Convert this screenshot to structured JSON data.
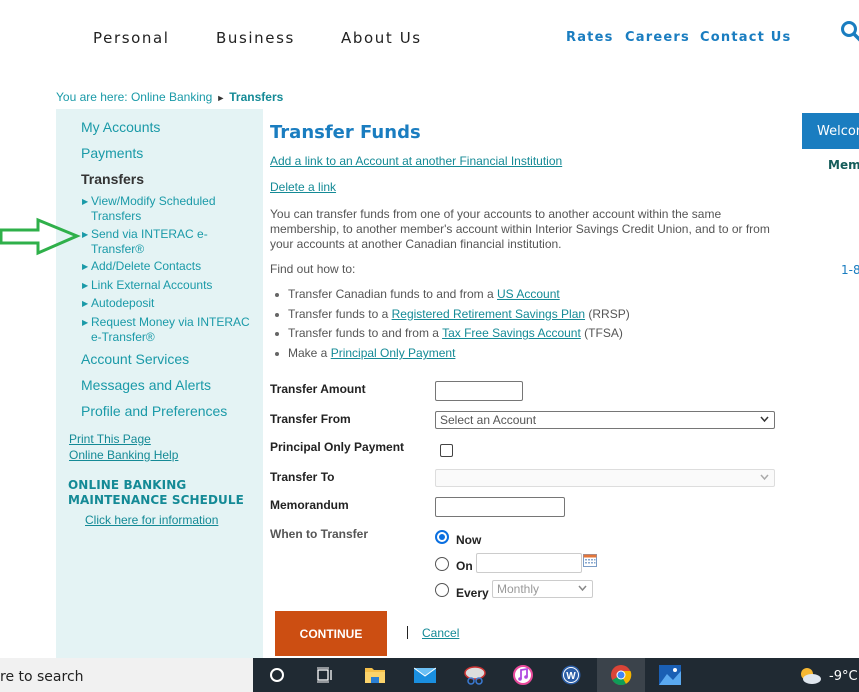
{
  "nav": {
    "main": [
      "Personal",
      "Business",
      "About Us"
    ],
    "util": [
      "Rates",
      "Careers",
      "Contact Us"
    ],
    "search_icon": "search-icon"
  },
  "breadcrumb": {
    "prefix": "You are here: Online Banking",
    "separator": "►",
    "current": "Transfers"
  },
  "sidebar": {
    "items": [
      {
        "label": "My Accounts"
      },
      {
        "label": "Payments"
      },
      {
        "label": "Transfers",
        "active": true
      },
      {
        "label": "Account Services"
      },
      {
        "label": "Messages and Alerts"
      },
      {
        "label": "Profile and Preferences"
      }
    ],
    "sub_items": [
      {
        "line1": "View/Modify Scheduled",
        "line2": "Transfers"
      },
      {
        "line1": "Send via INTERAC e-",
        "line2": "Transfer®"
      },
      {
        "line1": "Add/Delete Contacts"
      },
      {
        "line1": "Link External Accounts"
      },
      {
        "line1": "Autodeposit"
      },
      {
        "line1": "Request Money via INTERAC",
        "line2": "e-Transfer®"
      }
    ],
    "links": [
      "Print This Page",
      "Online Banking Help"
    ],
    "maintenance_title_1": "ONLINE BANKING",
    "maintenance_title_2": "MAINTENANCE SCHEDULE",
    "maintenance_link": "Click here for information"
  },
  "main": {
    "title": "Transfer Funds",
    "add_link": "Add a link to an Account at another Financial Institution",
    "delete_link": "Delete a link",
    "intro": "You can transfer funds from one of your accounts to another account within the same membership, to another member's account within Interior Savings Credit Union, and to or from your accounts at another Canadian financial institution.",
    "find_out": "Find out how to:",
    "howto": [
      {
        "pre": "Transfer Canadian funds to and from a ",
        "link": "US Account",
        "post": ""
      },
      {
        "pre": "Transfer funds to a ",
        "link": "Registered Retirement Savings Plan",
        "post": " (RRSP)"
      },
      {
        "pre": "Transfer funds to and from a ",
        "link": "Tax Free Savings Account",
        "post": " (TFSA)"
      },
      {
        "pre": "Make a ",
        "link": "Principal Only Payment",
        "post": ""
      }
    ]
  },
  "form": {
    "transfer_amount_label": "Transfer Amount",
    "transfer_amount_value": "",
    "transfer_from_label": "Transfer From",
    "transfer_from_value": "Select an Account",
    "principal_label": "Principal Only Payment",
    "principal_checked": false,
    "transfer_to_label": "Transfer To",
    "transfer_to_value": "",
    "memo_label": "Memorandum",
    "memo_value": "",
    "when_label": "When to Transfer",
    "when_options": [
      "Now",
      "On",
      "Every"
    ],
    "when_selected": "Now",
    "on_date_value": "",
    "every_value": "Monthly",
    "continue_label": "CONTINUE",
    "cancel_label": "Cancel"
  },
  "right_panel": {
    "welcome": "Welcome",
    "member": "Member",
    "phone": "1-8"
  },
  "taskbar": {
    "search_text": "Type here to search",
    "search_visible": "re to search",
    "icons": [
      "cortana-icon",
      "task-view-icon",
      "file-explorer-icon",
      "mail-icon",
      "snipping-tool-icon",
      "itunes-icon",
      "wps-icon",
      "chrome-icon",
      "photos-icon"
    ],
    "active_icon": "chrome-icon",
    "temperature": "-9°C"
  },
  "colors": {
    "brand_blue": "#1a7dc0",
    "teal": "#148a96",
    "sidebar_bg": "#e4f3f4",
    "continue_orange": "#cc4e12",
    "annotation_green": "#2fb04a"
  }
}
